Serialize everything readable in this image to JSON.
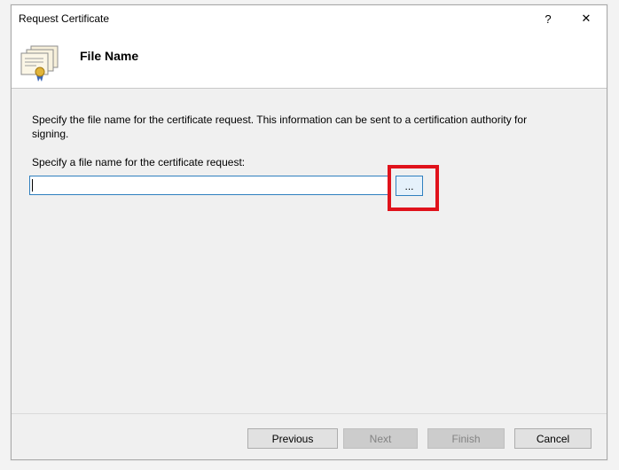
{
  "window": {
    "title": "Request Certificate",
    "help_glyph": "?",
    "close_glyph": "✕"
  },
  "header": {
    "title": "File Name",
    "icon": "certificate-icon"
  },
  "content": {
    "description": "Specify the file name for the certificate request. This information can be sent to a certification authority for signing.",
    "field_label": "Specify a file name for the certificate request:",
    "file_input_value": "",
    "browse_label": "..."
  },
  "footer": {
    "previous_label": "Previous",
    "next_label": "Next",
    "finish_label": "Finish",
    "cancel_label": "Cancel"
  },
  "colors": {
    "highlight": "#e0121b",
    "focus_border": "#2f7fbf"
  }
}
